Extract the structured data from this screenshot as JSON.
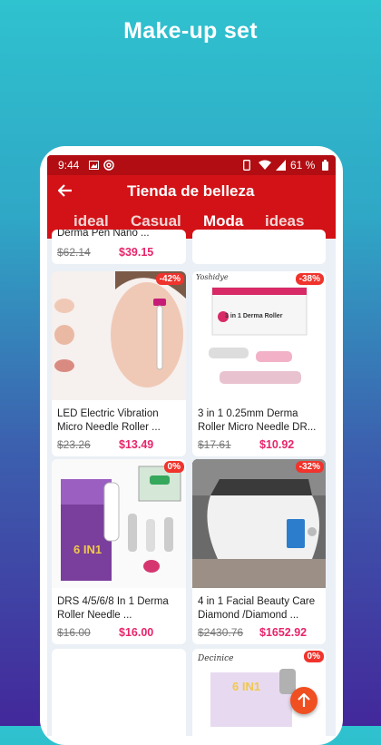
{
  "headline": "Make-up set",
  "status": {
    "time": "9:44",
    "battery": "61 %"
  },
  "appbar": {
    "title": "Tienda de belleza"
  },
  "tabs": [
    {
      "label": "ideal",
      "active": false
    },
    {
      "label": "Casual",
      "active": false
    },
    {
      "label": "Moda",
      "active": true
    },
    {
      "label": "ideas",
      "active": false
    }
  ],
  "products": [
    {
      "title": "Derma Pen Nano ...",
      "old_price": "$62.14",
      "price": "$39.15"
    },
    {
      "title": "",
      "old_price": "",
      "price": ""
    },
    {
      "title": "LED Electric Vibration Micro Needle Roller ...",
      "old_price": "$23.26",
      "price": "$13.49",
      "discount": "-42%"
    },
    {
      "title": "3 in 1 0.25mm Derma Roller Micro Needle DR...",
      "old_price": "$17.61",
      "price": "$10.92",
      "discount": "-38%",
      "image_text": "3 in 1 Derma Roller",
      "brand": "Yoshidye"
    },
    {
      "title": "DRS 4/5/6/8 In 1 Derma Roller Needle ...",
      "old_price": "$16.00",
      "price": "$16.00",
      "discount": "0%",
      "image_text": "6 IN1"
    },
    {
      "title": "4 in 1 Facial Beauty Care Diamond /Diamond ...",
      "old_price": "$2430.76",
      "price": "$1652.92",
      "discount": "-32%"
    },
    {
      "title": "",
      "old_price": "",
      "price": ""
    },
    {
      "title": "",
      "old_price": "",
      "price": "",
      "discount": "0%",
      "brand": "Decinice",
      "image_text": "6 IN1"
    }
  ],
  "icons": {
    "back": "arrow-left-icon",
    "fab": "arrow-up-icon"
  },
  "colors": {
    "appbar": "#d31217",
    "price": "#e8246a",
    "badge": "#f0332c",
    "fab": "#ef4f21"
  }
}
